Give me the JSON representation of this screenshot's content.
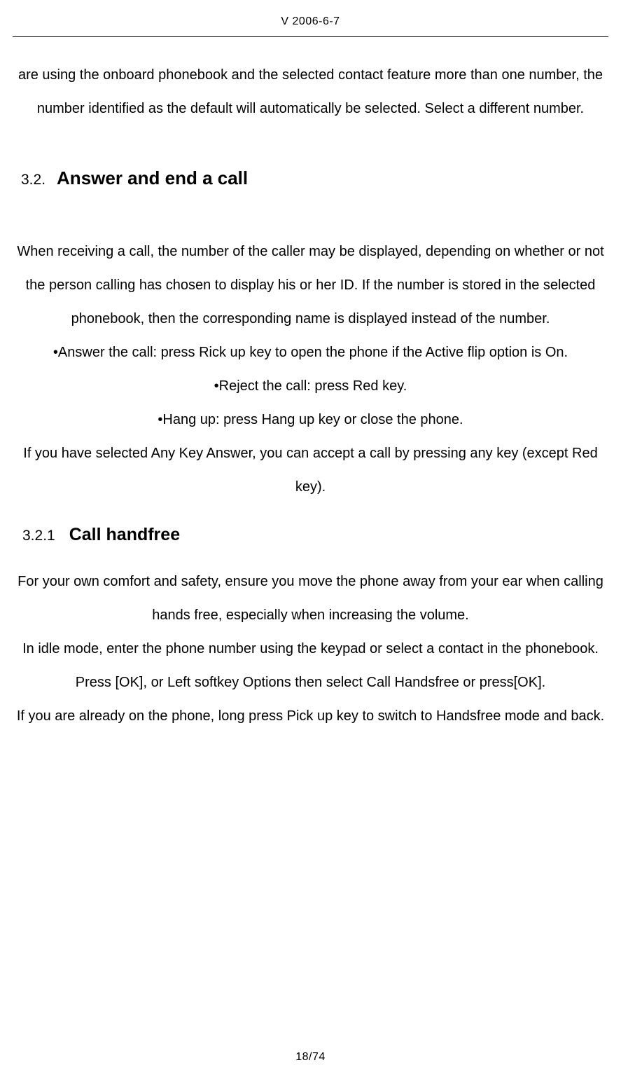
{
  "header": {
    "version_date": "V 2006-6-7"
  },
  "intro_paragraph": "are using the onboard phonebook and the selected contact feature more than one number, the number identified as the default will automatically be selected. Select a different number.",
  "section_3_2": {
    "number": "3.2.",
    "title": "Answer and end a call",
    "paragraph_1": "When receiving a call, the number of the caller may be displayed, depending on whether or not the person calling has chosen to display his or her ID. If the number is stored in the selected phonebook, then the corresponding name is displayed instead of the number.",
    "bullet_1": "•Answer the call: press Rick up key to open the phone if the Active flip option is On.",
    "bullet_2": "•Reject the call: press Red key.",
    "bullet_3": "•Hang up: press Hang up key or close the phone.",
    "paragraph_2": "If you have selected Any Key Answer, you can accept a call by pressing any key (except Red key)."
  },
  "section_3_2_1": {
    "number": "3.2.1",
    "title": "Call handfree",
    "paragraph_1": "For your own comfort and safety, ensure you move the phone away from your ear when calling hands free, especially when increasing the volume.",
    "paragraph_2": "In idle mode, enter the phone number using the keypad or select a contact in the phonebook.",
    "paragraph_3": "Press [OK], or Left softkey Options then select Call Handsfree or press[OK].",
    "paragraph_4": "If you are already on the phone, long press Pick up key to switch to Handsfree mode and back."
  },
  "footer": {
    "page_number": "18/74"
  }
}
